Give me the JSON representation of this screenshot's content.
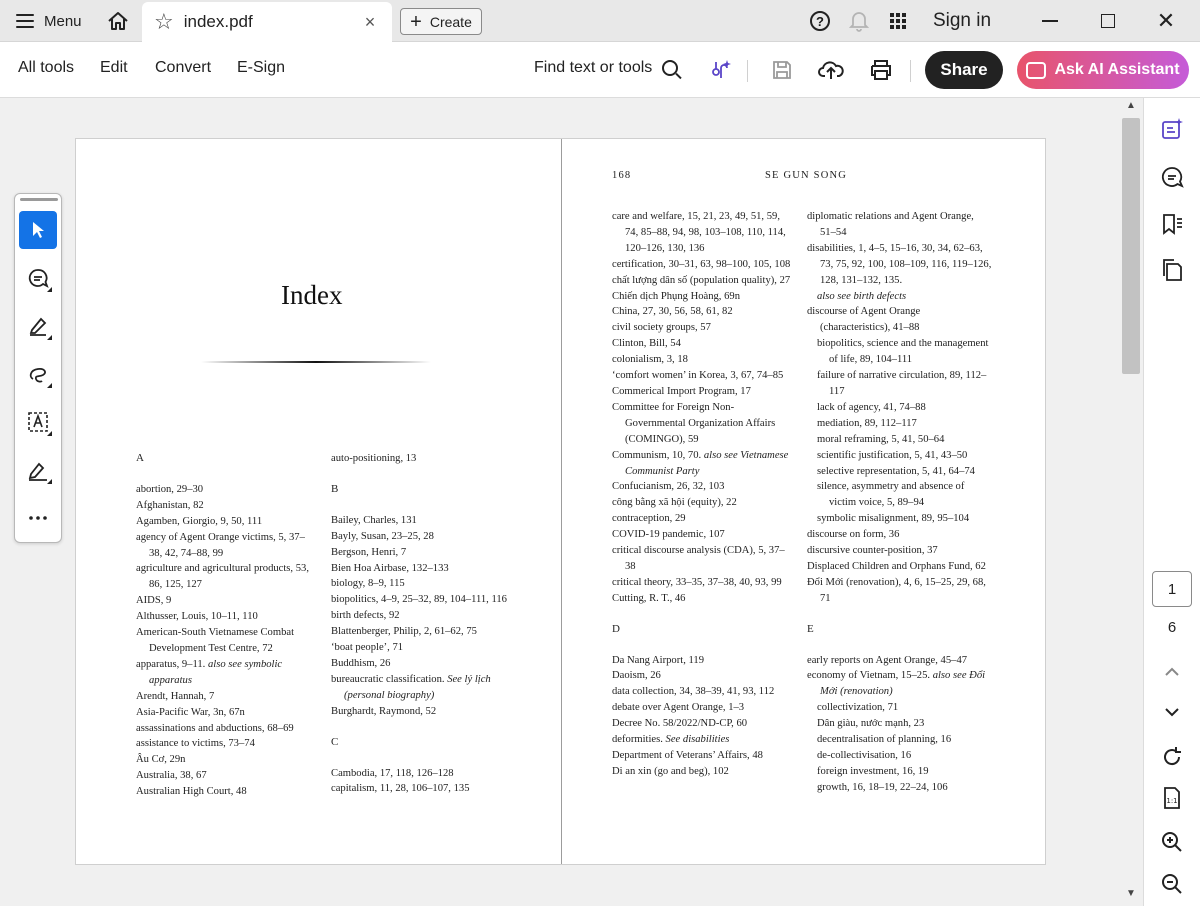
{
  "titlebar": {
    "menu_label": "Menu",
    "tab_title": "index.pdf",
    "tab_close": "×",
    "create_label": "Create",
    "signin_label": "Sign in",
    "help_glyph": "?",
    "close_glyph": "✕"
  },
  "toolbar": {
    "all_tools": "All tools",
    "edit": "Edit",
    "convert": "Convert",
    "esign": "E-Sign",
    "find": "Find text or tools",
    "share": "Share",
    "ai_assistant": "Ask AI Assistant"
  },
  "colors": {
    "accent": "#1473e6",
    "share_bg": "#222222",
    "ai_gradient_start": "#e8546b",
    "ai_gradient_end": "#c55bd8"
  },
  "icons": {
    "home": "home-icon",
    "star": "star-icon",
    "help": "help-icon",
    "bell": "bell-icon",
    "apps": "apps-grid-icon",
    "ai_tools": "ai-tools-icon",
    "save": "save-icon",
    "upload": "cloud-upload-icon",
    "print": "print-icon"
  },
  "left_page": {
    "title": "Index",
    "col1": [
      {
        "t": "A",
        "k": "letter"
      },
      {
        "t": "",
        "k": "gap"
      },
      {
        "t": "abortion, 29–30",
        "k": "entry"
      },
      {
        "t": "Afghanistan, 82",
        "k": "entry"
      },
      {
        "t": "Agamben, Giorgio, 9, 50, 111",
        "k": "entry"
      },
      {
        "t": "agency of Agent Orange victims, 5, 37–38, 42, 74–88, 99",
        "k": "entry"
      },
      {
        "t": "agriculture and agricultural products, 53, 86, 125, 127",
        "k": "entry"
      },
      {
        "t": "AIDS, 9",
        "k": "entry"
      },
      {
        "t": "Althusser, Louis, 10–11, 110",
        "k": "entry"
      },
      {
        "t": "American-South Vietnamese Combat Development Test Centre, 72",
        "k": "entry"
      },
      {
        "t": "apparatus, 9–11. ",
        "i": "also see symbolic apparatus",
        "k": "entry"
      },
      {
        "t": "Arendt, Hannah, 7",
        "k": "entry"
      },
      {
        "t": "Asia-Pacific War, 3n, 67n",
        "k": "entry"
      },
      {
        "t": "assassinations and abductions, 68–69",
        "k": "entry"
      },
      {
        "t": "assistance to victims, 73–74",
        "k": "entry"
      },
      {
        "t": "Âu Cơ, 29n",
        "k": "entry"
      },
      {
        "t": "Australia, 38, 67",
        "k": "entry"
      },
      {
        "t": "Australian High Court, 48",
        "k": "entry"
      }
    ],
    "col2": [
      {
        "t": "auto-positioning, 13",
        "k": "entry"
      },
      {
        "t": "",
        "k": "gap"
      },
      {
        "t": "B",
        "k": "letter"
      },
      {
        "t": "",
        "k": "gap"
      },
      {
        "t": "Bailey, Charles, 131",
        "k": "entry"
      },
      {
        "t": "Bayly, Susan, 23–25, 28",
        "k": "entry"
      },
      {
        "t": "Bergson, Henri, 7",
        "k": "entry"
      },
      {
        "t": "Bien Hoa Airbase, 132–133",
        "k": "entry"
      },
      {
        "t": "biology, 8–9, 115",
        "k": "entry"
      },
      {
        "t": "biopolitics, 4–9, 25–32, 89, 104–111, 116",
        "k": "entry"
      },
      {
        "t": "birth defects, 92",
        "k": "entry"
      },
      {
        "t": "Blattenberger, Philip, 2, 61–62, 75",
        "k": "entry"
      },
      {
        "t": "‘boat people’, 71",
        "k": "entry"
      },
      {
        "t": "Buddhism, 26",
        "k": "entry"
      },
      {
        "t": "bureaucratic classification. ",
        "i": "See lý lịch (personal biography)",
        "k": "entry"
      },
      {
        "t": "Burghardt, Raymond, 52",
        "k": "entry"
      },
      {
        "t": "",
        "k": "gap"
      },
      {
        "t": "C",
        "k": "letter"
      },
      {
        "t": "",
        "k": "gap"
      },
      {
        "t": "Cambodia, 17, 118, 126–128",
        "k": "entry"
      },
      {
        "t": "capitalism, 11, 28, 106–107, 135",
        "k": "entry"
      }
    ]
  },
  "right_page": {
    "page_number": "168",
    "running_head": "SE GUN SONG",
    "col1": [
      {
        "t": "care and welfare, 15, 21, 23, 49, 51, 59, 74, 85–88, 94, 98, 103–108, 110, 114, 120–126, 130, 136",
        "k": "entry"
      },
      {
        "t": "certification, 30–31, 63, 98–100, 105, 108",
        "k": "entry"
      },
      {
        "t": "chất lượng dân số (population quality), 27",
        "k": "entry"
      },
      {
        "t": "Chiến dịch Phụng Hoàng, 69n",
        "k": "entry"
      },
      {
        "t": "China, 27, 30, 56, 58, 61, 82",
        "k": "entry"
      },
      {
        "t": "civil society groups, 57",
        "k": "entry"
      },
      {
        "t": "Clinton, Bill, 54",
        "k": "entry"
      },
      {
        "t": "colonialism, 3, 18",
        "k": "entry"
      },
      {
        "t": "‘comfort women’ in Korea, 3, 67, 74–85",
        "k": "entry"
      },
      {
        "t": "Commerical Import Program, 17",
        "k": "entry"
      },
      {
        "t": "Committee for Foreign Non-Governmental Organization Affairs (COMINGO), 59",
        "k": "entry"
      },
      {
        "t": "Communism, 10, 70. ",
        "i": "also see Vietnamese Communist Party",
        "k": "entry"
      },
      {
        "t": "Confucianism, 26, 32, 103",
        "k": "entry"
      },
      {
        "t": "công bằng xã hội (equity), 22",
        "k": "entry"
      },
      {
        "t": "contraception, 29",
        "k": "entry"
      },
      {
        "t": "COVID-19 pandemic, 107",
        "k": "entry"
      },
      {
        "t": "critical discourse analysis (CDA), 5, 37–38",
        "k": "entry"
      },
      {
        "t": "critical theory, 33–35, 37–38, 40, 93, 99",
        "k": "entry"
      },
      {
        "t": "Cutting, R. T., 46",
        "k": "entry"
      },
      {
        "t": "",
        "k": "gap"
      },
      {
        "t": "D",
        "k": "letter"
      },
      {
        "t": "",
        "k": "gap"
      },
      {
        "t": "Da Nang Airport, 119",
        "k": "entry"
      },
      {
        "t": "Daoism, 26",
        "k": "entry"
      },
      {
        "t": "data collection, 34, 38–39, 41, 93, 112",
        "k": "entry"
      },
      {
        "t": "debate over Agent Orange, 1–3",
        "k": "entry"
      },
      {
        "t": "Decree No. 58/2022/ND-CP, 60",
        "k": "entry"
      },
      {
        "t": "deformities. ",
        "i": "See disabilities",
        "k": "entry"
      },
      {
        "t": "Department of Veterans’ Affairs, 48",
        "k": "entry"
      },
      {
        "t": "Di an xin (go and beg), 102",
        "k": "entry"
      }
    ],
    "col2": [
      {
        "t": "diplomatic relations and Agent Orange, 51–54",
        "k": "entry"
      },
      {
        "t": "disabilities, 1, 4–5, 15–16, 30, 34, 62–63, 73, 75, 92, 100, 108–109, 116, 119–126, 128, 131–132, 135.",
        "k": "entry"
      },
      {
        "t": "",
        "i": "also see birth defects",
        "k": "sub"
      },
      {
        "t": "discourse of Agent Orange (characteristics), 41–88",
        "k": "entry"
      },
      {
        "t": "biopolitics, science and the management of life, 89, 104–111",
        "k": "sub"
      },
      {
        "t": "failure of narrative circulation, 89, 112–117",
        "k": "sub"
      },
      {
        "t": "lack of agency, 41, 74–88",
        "k": "sub"
      },
      {
        "t": "mediation, 89, 112–117",
        "k": "sub"
      },
      {
        "t": "moral reframing, 5, 41, 50–64",
        "k": "sub"
      },
      {
        "t": "scientific justification, 5, 41, 43–50",
        "k": "sub"
      },
      {
        "t": "selective representation, 5, 41, 64–74",
        "k": "sub"
      },
      {
        "t": "silence, asymmetry and absence of victim voice, 5, 89–94",
        "k": "sub"
      },
      {
        "t": "symbolic misalignment, 89, 95–104",
        "k": "sub"
      },
      {
        "t": "discourse on form, 36",
        "k": "entry"
      },
      {
        "t": "discursive counter-position, 37",
        "k": "entry"
      },
      {
        "t": "Displaced Children and Orphans Fund, 62",
        "k": "entry"
      },
      {
        "t": "Đổi Mới (renovation), 4, 6, 15–25, 29, 68, 71",
        "k": "entry"
      },
      {
        "t": "",
        "k": "gap"
      },
      {
        "t": "E",
        "k": "letter"
      },
      {
        "t": "",
        "k": "gap"
      },
      {
        "t": "early reports on Agent Orange, 45–47",
        "k": "entry"
      },
      {
        "t": "economy of Vietnam, 15–25. ",
        "i": "also see Đổi Mới (renovation)",
        "k": "entry"
      },
      {
        "t": "collectivization, 71",
        "k": "sub"
      },
      {
        "t": "Dân giàu, nước mạnh, 23",
        "k": "sub"
      },
      {
        "t": "decentralisation of planning, 16",
        "k": "sub"
      },
      {
        "t": "de-collectivisation, 16",
        "k": "sub"
      },
      {
        "t": "foreign investment, 16, 19",
        "k": "sub"
      },
      {
        "t": "growth, 16, 18–19, 22–24, 106",
        "k": "sub"
      }
    ]
  },
  "page_nav": {
    "current": "1",
    "total": "6"
  }
}
